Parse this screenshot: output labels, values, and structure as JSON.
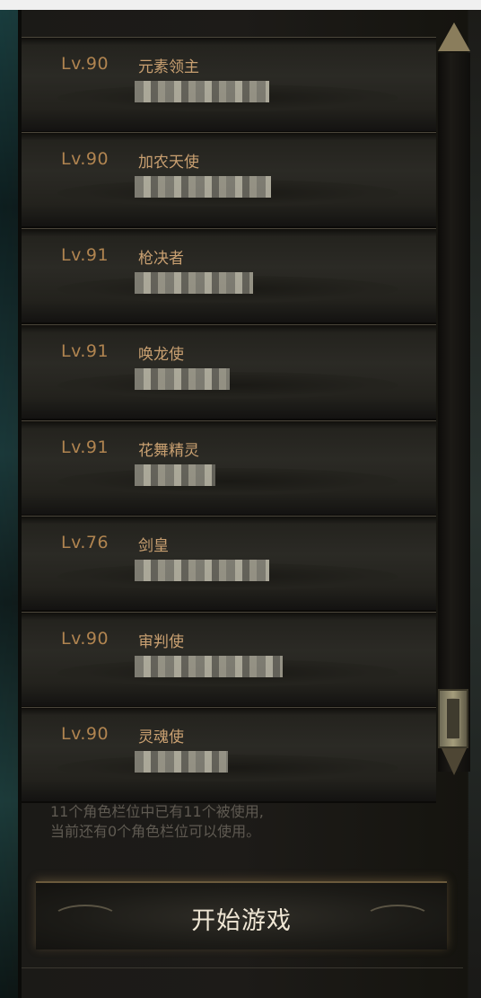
{
  "characters": [
    {
      "level": "Lv.90",
      "class": "元素领主"
    },
    {
      "level": "Lv.90",
      "class": "加农天使"
    },
    {
      "level": "Lv.91",
      "class": "枪决者"
    },
    {
      "level": "Lv.91",
      "class": "唤龙使"
    },
    {
      "level": "Lv.91",
      "class": "花舞精灵"
    },
    {
      "level": "Lv.76",
      "class": "剑皇"
    },
    {
      "level": "Lv.90",
      "class": "审判使"
    },
    {
      "level": "Lv.90",
      "class": "灵魂使"
    }
  ],
  "slots_info": {
    "line1": "11个角色栏位中已有11个被使用,",
    "line2": "当前还有0个角色栏位可以使用。"
  },
  "start_button": {
    "label": "开始游戏"
  },
  "colors": {
    "level_text": "#b08450",
    "class_text": "#c9a071",
    "info_text": "#5f5a52"
  }
}
